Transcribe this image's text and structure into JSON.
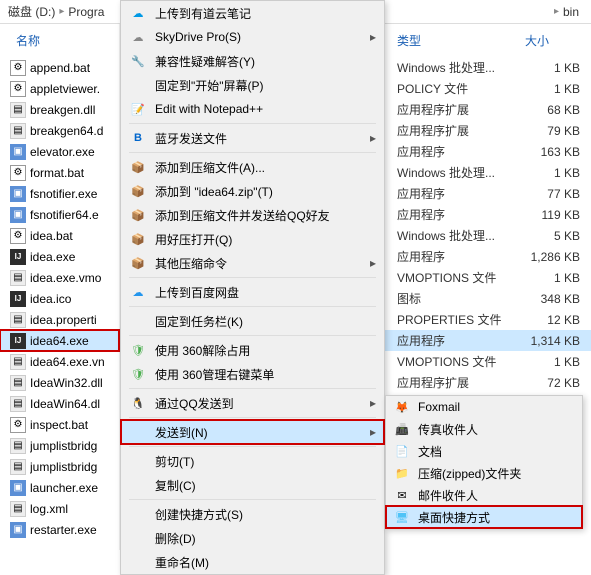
{
  "breadcrumb": {
    "disk": "磁盘 (D:)",
    "folder1": "Progra",
    "folder_end": "bin"
  },
  "headers": {
    "name": "名称",
    "type": "类型",
    "size": "大小"
  },
  "files": [
    {
      "name": "append.bat",
      "icon": "bat"
    },
    {
      "name": "appletviewer.",
      "icon": "bat"
    },
    {
      "name": "breakgen.dll",
      "icon": "dll"
    },
    {
      "name": "breakgen64.d",
      "icon": "dll"
    },
    {
      "name": "elevator.exe",
      "icon": "exe"
    },
    {
      "name": "format.bat",
      "icon": "bat"
    },
    {
      "name": "fsnotifier.exe",
      "icon": "exe"
    },
    {
      "name": "fsnotifier64.e",
      "icon": "exe"
    },
    {
      "name": "idea.bat",
      "icon": "bat"
    },
    {
      "name": "idea.exe",
      "icon": "ij"
    },
    {
      "name": "idea.exe.vmo",
      "icon": "dll"
    },
    {
      "name": "idea.ico",
      "icon": "ij"
    },
    {
      "name": "idea.properti",
      "icon": "dll"
    },
    {
      "name": "idea64.exe",
      "icon": "ij",
      "sel": true
    },
    {
      "name": "idea64.exe.vn",
      "icon": "dll"
    },
    {
      "name": "IdeaWin32.dll",
      "icon": "dll"
    },
    {
      "name": "IdeaWin64.dl",
      "icon": "dll"
    },
    {
      "name": "inspect.bat",
      "icon": "bat"
    },
    {
      "name": "jumplistbridg",
      "icon": "dll"
    },
    {
      "name": "jumplistbridg",
      "icon": "dll"
    },
    {
      "name": "launcher.exe",
      "icon": "exe"
    },
    {
      "name": "log.xml",
      "icon": "dll"
    },
    {
      "name": "restarter.exe",
      "icon": "exe"
    }
  ],
  "menu": [
    {
      "icon": "☁",
      "label": "上传到有道云笔记",
      "color": "#0099e5"
    },
    {
      "icon": "☁",
      "label": "SkyDrive Pro(S)",
      "arrow": true,
      "color": "#888"
    },
    {
      "icon": "🔧",
      "label": "兼容性疑难解答(Y)"
    },
    {
      "icon": "",
      "label": "固定到\"开始\"屏幕(P)"
    },
    {
      "icon": "📝",
      "label": "Edit with Notepad++",
      "color": "#8bc34a"
    },
    {
      "sep": true
    },
    {
      "icon": "B",
      "label": "蓝牙发送文件",
      "arrow": true,
      "color": "#0066cc",
      "bold": true
    },
    {
      "sep": true
    },
    {
      "icon": "📦",
      "label": "添加到压缩文件(A)...",
      "color": "#c89b3c"
    },
    {
      "icon": "📦",
      "label": "添加到 \"idea64.zip\"(T)",
      "color": "#c89b3c"
    },
    {
      "icon": "📦",
      "label": "添加到压缩文件并发送给QQ好友",
      "color": "#c89b3c"
    },
    {
      "icon": "📦",
      "label": "用好压打开(Q)",
      "color": "#c89b3c"
    },
    {
      "icon": "📦",
      "label": "其他压缩命令",
      "arrow": true,
      "color": "#c89b3c"
    },
    {
      "sep": true
    },
    {
      "icon": "☁",
      "label": "上传到百度网盘",
      "color": "#2496ed"
    },
    {
      "sep": true
    },
    {
      "icon": "",
      "label": "固定到任务栏(K)"
    },
    {
      "sep": true
    },
    {
      "icon": "🛡",
      "label": "使用 360解除占用",
      "color": "#4caf50"
    },
    {
      "icon": "🛡",
      "label": "使用 360管理右键菜单",
      "color": "#4caf50"
    },
    {
      "sep": true
    },
    {
      "icon": "🐧",
      "label": "通过QQ发送到",
      "arrow": true
    },
    {
      "sep": true
    },
    {
      "icon": "",
      "label": "发送到(N)",
      "arrow": true,
      "hl": true
    },
    {
      "sep": true
    },
    {
      "icon": "",
      "label": "剪切(T)"
    },
    {
      "icon": "",
      "label": "复制(C)"
    },
    {
      "sep": true
    },
    {
      "icon": "",
      "label": "创建快捷方式(S)"
    },
    {
      "icon": "",
      "label": "删除(D)"
    },
    {
      "icon": "",
      "label": "重命名(M)"
    }
  ],
  "details": [
    {
      "type": "Windows 批处理...",
      "size": "1 KB"
    },
    {
      "type": "POLICY 文件",
      "size": "1 KB"
    },
    {
      "type": "应用程序扩展",
      "size": "68 KB"
    },
    {
      "type": "应用程序扩展",
      "size": "79 KB"
    },
    {
      "type": "应用程序",
      "size": "163 KB"
    },
    {
      "type": "Windows 批处理...",
      "size": "1 KB"
    },
    {
      "type": "应用程序",
      "size": "77 KB"
    },
    {
      "type": "应用程序",
      "size": "119 KB"
    },
    {
      "type": "Windows 批处理...",
      "size": "5 KB"
    },
    {
      "type": "应用程序",
      "size": "1,286 KB"
    },
    {
      "type": "VMOPTIONS 文件",
      "size": "1 KB"
    },
    {
      "type": "图标",
      "size": "348 KB"
    },
    {
      "type": "PROPERTIES 文件",
      "size": "12 KB"
    },
    {
      "type": "应用程序",
      "size": "1,314 KB",
      "sel": true
    },
    {
      "type": "VMOPTIONS 文件",
      "size": "1 KB"
    },
    {
      "type": "应用程序扩展",
      "size": "72 KB"
    }
  ],
  "submenu": [
    {
      "icon": "🦊",
      "label": "Foxmail",
      "color": "#ff6600"
    },
    {
      "icon": "📠",
      "label": "传真收件人"
    },
    {
      "icon": "📄",
      "label": "文档",
      "color": "#ffc107"
    },
    {
      "icon": "📁",
      "label": "压缩(zipped)文件夹",
      "color": "#ffc107"
    },
    {
      "icon": "✉",
      "label": "邮件收件人"
    },
    {
      "icon": "🖥",
      "label": "桌面快捷方式",
      "hl": true,
      "color": "#4fc3f7"
    }
  ]
}
